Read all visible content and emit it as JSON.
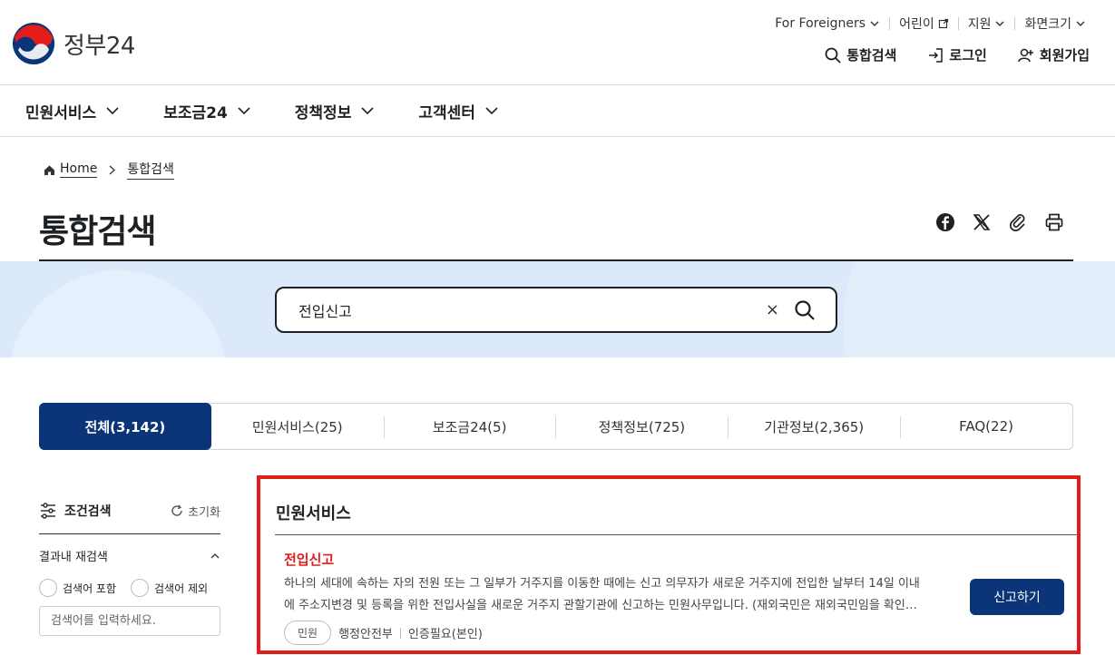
{
  "header": {
    "logo_text": "정부24",
    "util": {
      "foreigners": "For Foreigners",
      "kids": "어린이",
      "support": "지원",
      "screen_size": "화면크기"
    },
    "actions": {
      "search": "통합검색",
      "login": "로그인",
      "signup": "회원가입"
    }
  },
  "nav": {
    "items": [
      {
        "label": "민원서비스"
      },
      {
        "label": "보조금24"
      },
      {
        "label": "정책정보"
      },
      {
        "label": "고객센터"
      }
    ]
  },
  "breadcrumb": {
    "home": "Home",
    "current": "통합검색"
  },
  "page": {
    "title": "통합검색"
  },
  "search": {
    "value": "전입신고",
    "clear": "×"
  },
  "tabs": [
    {
      "label": "전체(3,142)",
      "active": true
    },
    {
      "label": "민원서비스(25)"
    },
    {
      "label": "보조금24(5)"
    },
    {
      "label": "정책정보(725)"
    },
    {
      "label": "기관정보(2,365)"
    },
    {
      "label": "FAQ(22)"
    }
  ],
  "sidebar": {
    "title": "조건검색",
    "reset": "초기화",
    "subsection": "결과내 재검색",
    "radio_include": "검색어 포함",
    "radio_exclude": "검색어 제외",
    "input_placeholder": "검색어를 입력하세요."
  },
  "results": {
    "section_title": "민원서비스",
    "item": {
      "title": "전입신고",
      "desc_line1": "하나의 세대에 속하는 자의 전원 또는 그 일부가 거주지를 이동한 때에는 신고 의무자가 새로운 거주지에 전입한 날부터 14일 이내",
      "desc_line2": "에 주소지변경 및 등록을 위한 전입사실을 새로운 거주지 관할기관에 신고하는 민원사무입니다. (재외국민은 재외국민임을 확인…",
      "badge": "민원",
      "agency": "행정안전부",
      "auth": "인증필요(본인)",
      "button": "신고하기"
    }
  },
  "colors": {
    "primary": "#0b3479",
    "highlight": "#e31c1c",
    "band": "#dbe9fb"
  }
}
